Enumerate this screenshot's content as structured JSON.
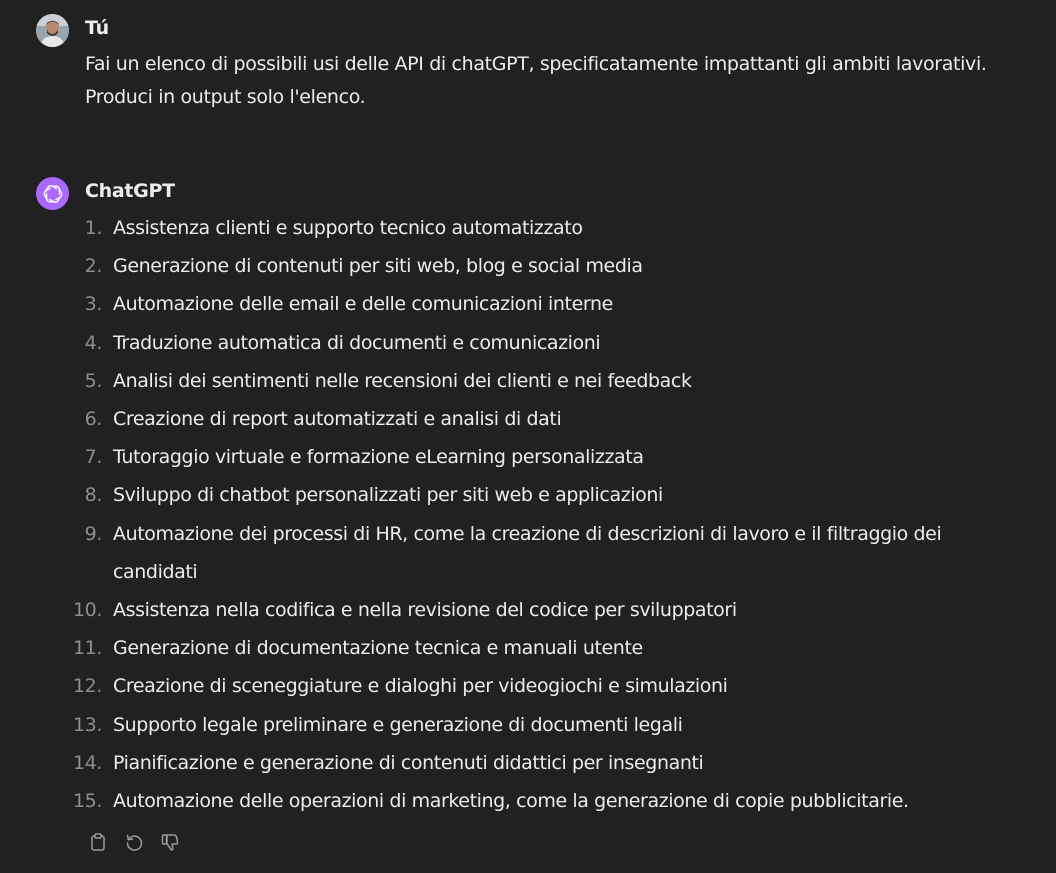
{
  "user_message": {
    "author": "Tú",
    "lines": [
      "Fai un elenco di possibili usi delle API di chatGPT, specificatamente impattanti gli ambiti lavorativi.",
      "Produci in output solo l'elenco."
    ]
  },
  "assistant_message": {
    "author": "ChatGPT",
    "items": [
      {
        "num": "1.",
        "text": "Assistenza clienti e supporto tecnico automatizzato"
      },
      {
        "num": "2.",
        "text": "Generazione di contenuti per siti web, blog e social media"
      },
      {
        "num": "3.",
        "text": "Automazione delle email e delle comunicazioni interne"
      },
      {
        "num": "4.",
        "text": "Traduzione automatica di documenti e comunicazioni"
      },
      {
        "num": "5.",
        "text": "Analisi dei sentimenti nelle recensioni dei clienti e nei feedback"
      },
      {
        "num": "6.",
        "text": "Creazione di report automatizzati e analisi di dati"
      },
      {
        "num": "7.",
        "text": "Tutoraggio virtuale e formazione eLearning personalizzata"
      },
      {
        "num": "8.",
        "text": "Sviluppo di chatbot personalizzati per siti web e applicazioni"
      },
      {
        "num": "9.",
        "text": "Automazione dei processi di HR, come la creazione di descrizioni di lavoro e il filtraggio dei candidati"
      },
      {
        "num": "10.",
        "text": "Assistenza nella codifica e nella revisione del codice per sviluppatori"
      },
      {
        "num": "11.",
        "text": "Generazione di documentazione tecnica e manuali utente"
      },
      {
        "num": "12.",
        "text": "Creazione di sceneggiature e dialoghi per videogiochi e simulazioni"
      },
      {
        "num": "13.",
        "text": "Supporto legale preliminare e generazione di documenti legali"
      },
      {
        "num": "14.",
        "text": "Pianificazione e generazione di contenuti didattici per insegnanti"
      },
      {
        "num": "15.",
        "text": "Automazione delle operazioni di marketing, come la generazione di copie pubblicitarie."
      }
    ],
    "actions": [
      "clipboard-icon",
      "regenerate-icon",
      "thumbs-down-icon"
    ]
  },
  "colors": {
    "background": "#212121",
    "text": "#ececec",
    "number": "#8e8e8e",
    "gpt_avatar": "#ab68ff"
  }
}
